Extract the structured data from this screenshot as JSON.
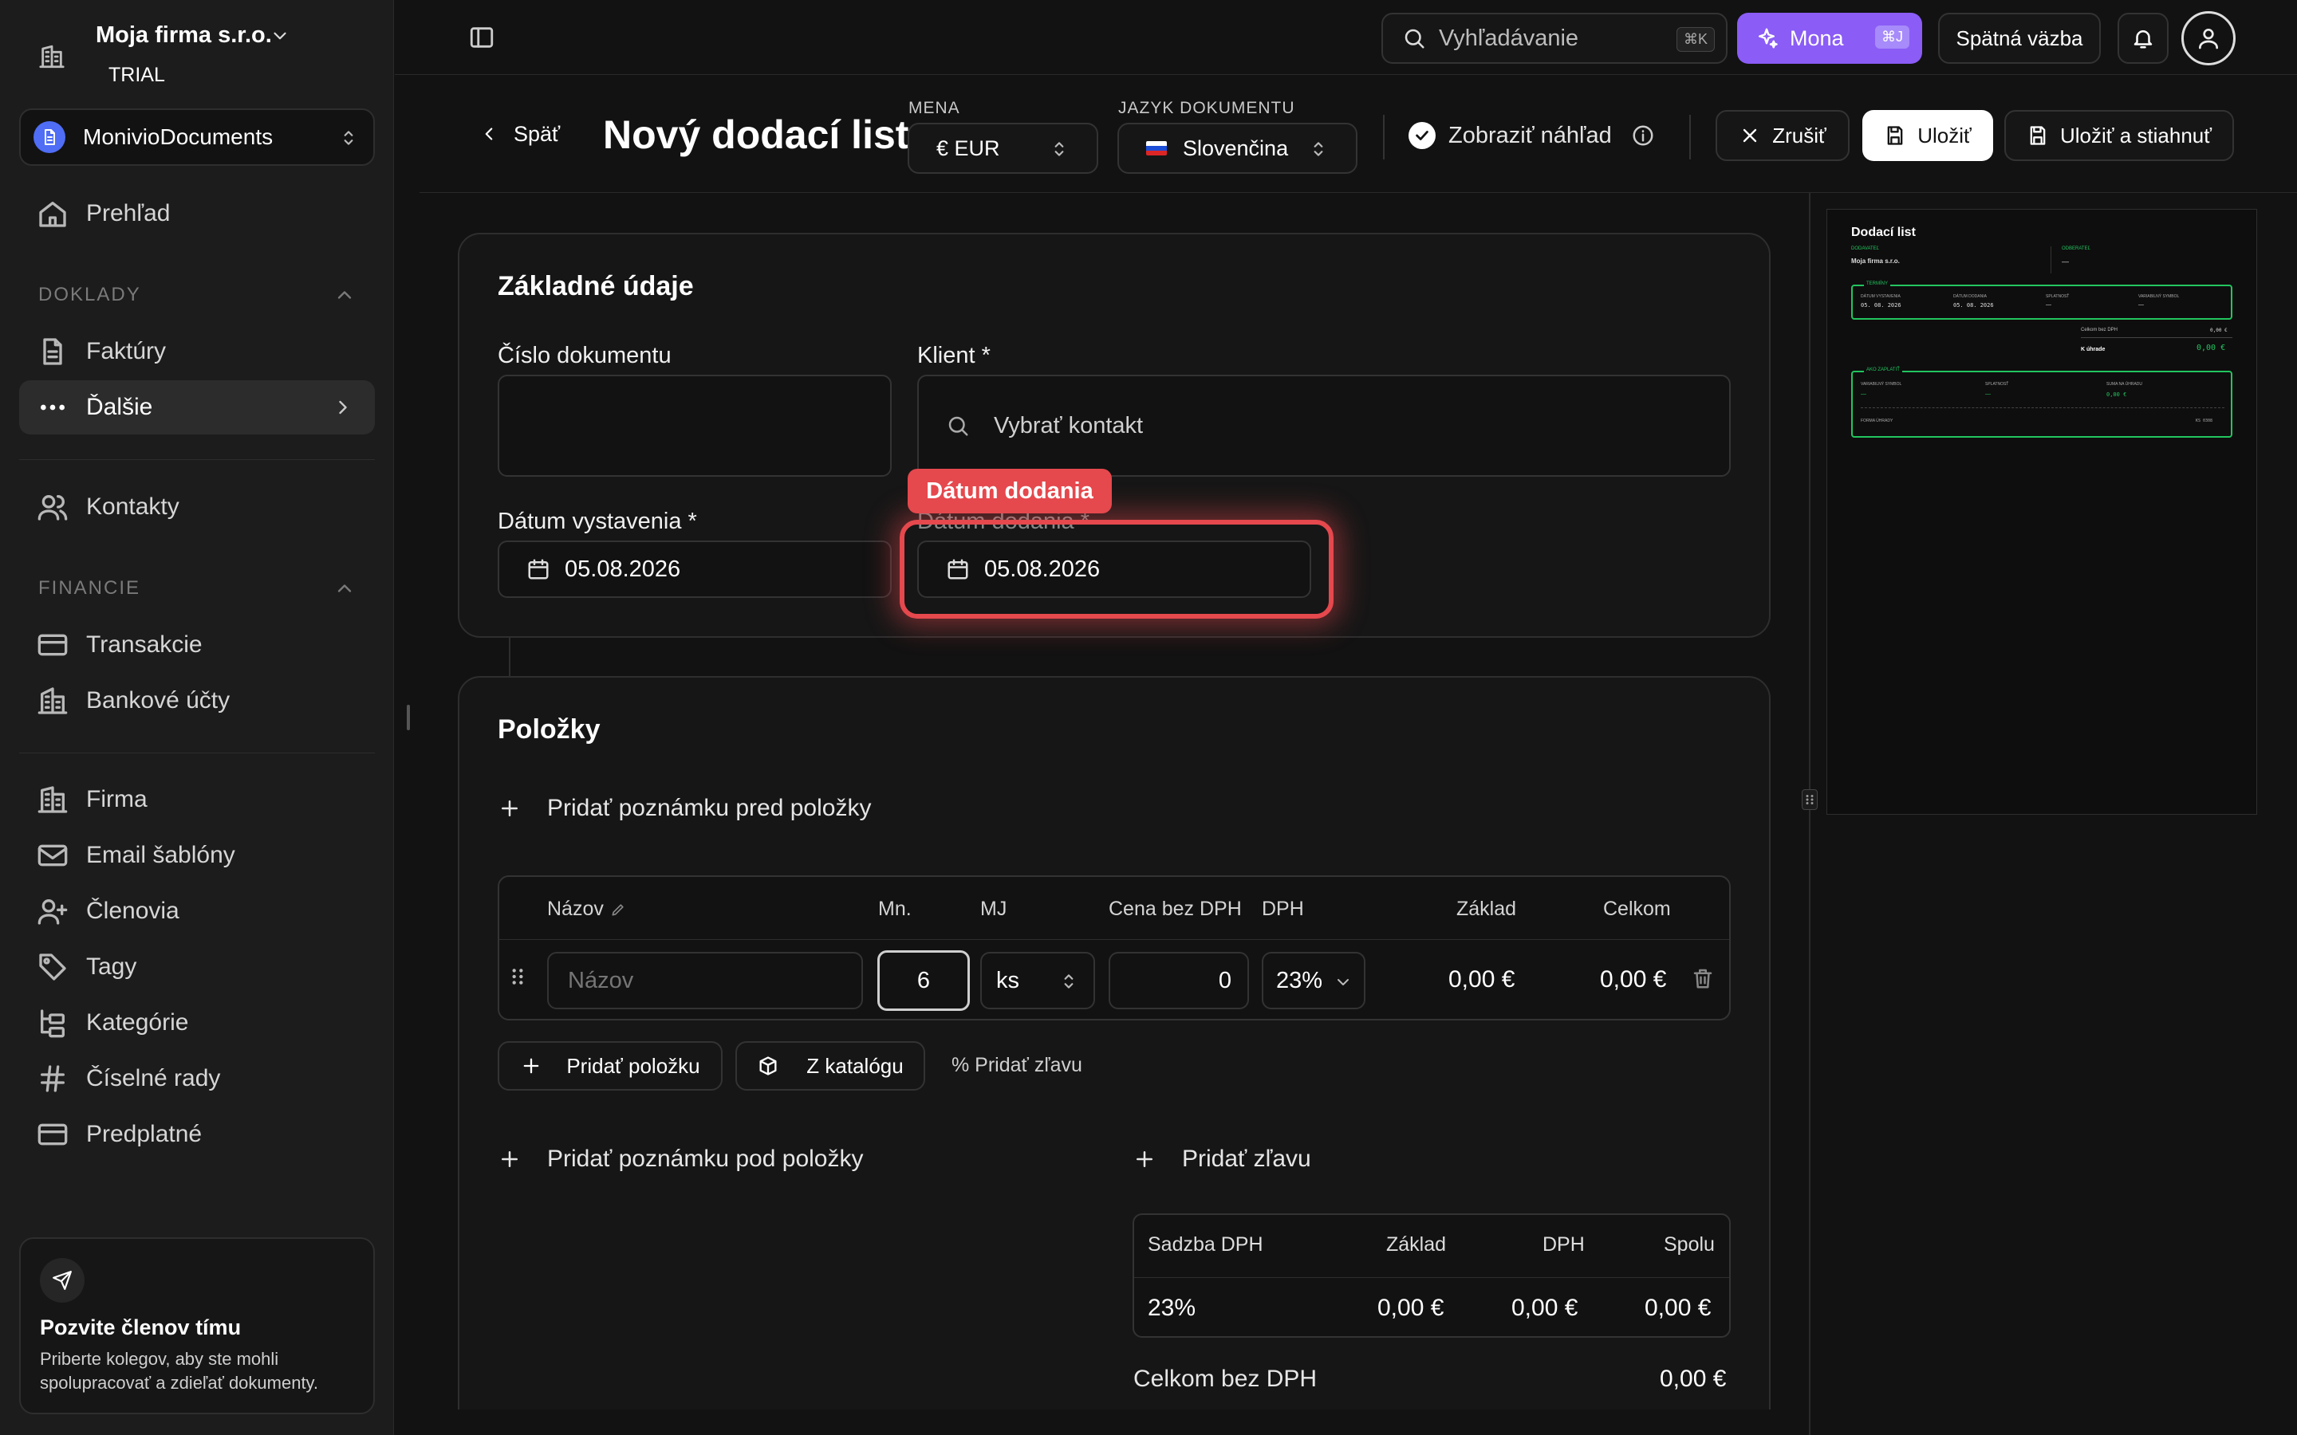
{
  "sidebar": {
    "company_name": "Moja firma s.r.o.",
    "plan_badge": "TRIAL",
    "workspace": "MonivioDocuments",
    "overview": "Prehľad",
    "section_docs": "DOKLADY",
    "invoices": "Faktúry",
    "more": "Ďalšie",
    "contacts": "Kontakty",
    "section_finance": "FINANCIE",
    "transactions": "Transakcie",
    "bank_accounts": "Bankové účty",
    "company": "Firma",
    "email_templates": "Email šablóny",
    "members": "Členovia",
    "tags": "Tagy",
    "categories": "Kategórie",
    "number_series": "Číselné rady",
    "subscription": "Predplatné",
    "invite_title": "Pozvite členov tímu",
    "invite_text": "Priberte kolegov, aby ste mohli spolupracovať a zdieľať dokumenty."
  },
  "topbar": {
    "search_placeholder": "Vyhľadávanie",
    "search_shortcut": "⌘K",
    "ai_label": "Mona",
    "ai_shortcut": "⌘J",
    "feedback": "Spätná väzba"
  },
  "header": {
    "back": "Späť",
    "title": "Nový dodací list",
    "currency_label": "MENA",
    "currency_value": "€ EUR",
    "language_label": "JAZYK DOKUMENTU",
    "language_value": "Slovenčina",
    "preview_toggle": "Zobraziť náhľad",
    "cancel": "Zrušiť",
    "save": "Uložiť",
    "save_download": "Uložiť a stiahnuť"
  },
  "basic": {
    "title": "Základné údaje",
    "doc_number_label": "Číslo dokumentu",
    "doc_number_value": "",
    "client_label": "Klient *",
    "client_placeholder": "Vybrať kontakt",
    "issue_date_label": "Dátum vystavenia *",
    "issue_date_value": "05.08.2026",
    "delivery_date_label": "Dátum dodania *",
    "delivery_date_value": "05.08.2026",
    "highlight_tooltip": "Dátum dodania"
  },
  "items": {
    "title": "Položky",
    "add_note_before": "Pridať poznámku pred položky",
    "columns": [
      "Názov",
      "Mn.",
      "MJ",
      "Cena bez DPH",
      "DPH",
      "Základ",
      "Celkom"
    ],
    "row": {
      "name_placeholder": "Názov",
      "qty": "6",
      "unit": "ks",
      "price": "0",
      "vat": "23%",
      "base": "0,00 €",
      "total": "0,00 €"
    },
    "add_item": "Pridať položku",
    "from_catalog": "Z katalógu",
    "add_discount_small": "% Pridať zľavu",
    "add_note_after": "Pridať poznámku pod položky",
    "add_discount": "Pridať zľavu"
  },
  "vat_summary": {
    "columns": [
      "Sadzba DPH",
      "Základ",
      "DPH",
      "Spolu"
    ],
    "row": [
      "23%",
      "0,00 €",
      "0,00 €",
      "0,00 €"
    ],
    "total_label": "Celkom bez DPH",
    "total_value": "0,00 €"
  },
  "preview": {
    "doc_title": "Dodací list",
    "supplier_label": "DODAVATEĽ",
    "supplier": "Moja firma s.r.o.",
    "customer_label": "ODBERATEĽ",
    "customer": "—",
    "terms_label": "TERMÍNY",
    "issue_label": "DÁTUM VYSTAVENIA",
    "issue": "05. 08. 2026",
    "delivery_label": "DÁTUM DODANIA",
    "delivery": "05. 08. 2026",
    "due_label": "SPLATNOSŤ",
    "due": "—",
    "vs_label": "VARIABILNÝ SYMBOL",
    "vs": "—",
    "total_no_vat_label": "Celkom bez DPH",
    "total_no_vat": "0,00 €",
    "to_pay_label": "K úhrade",
    "to_pay": "0,00 €",
    "how_to_pay_label": "AKO ZAPLATIŤ",
    "pay_vs_label": "VARIABILNÝ SYMBOL",
    "pay_vs": "—",
    "pay_due_label": "SPLATNOSŤ",
    "pay_due": "—",
    "pay_amount_label": "SUMA NA ÚHRADU",
    "pay_amount": "0,00 €",
    "payment_form_label": "FORMA ÚHRADY",
    "payment_form": "KS 0308"
  },
  "colors": {
    "accent_purple": "#8b5cf6",
    "highlight_red": "#e5484d",
    "preview_green": "#22c55e"
  }
}
